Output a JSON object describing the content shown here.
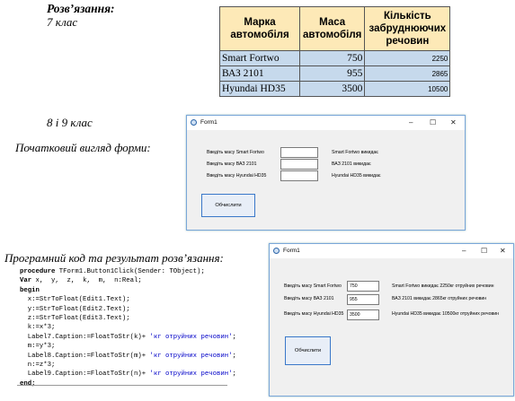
{
  "heading": "Розв’язання:",
  "grade7": "7 клас",
  "grade89": "8 і 9 клас",
  "initial_form_label": "Початковий вигляд форми:",
  "code_heading": "Програмний код та результат розв’язання:",
  "table": {
    "headers": [
      "Марка автомобіля",
      "Маса автомобіля",
      "Кількість забруднюючих речовин"
    ],
    "rows": [
      [
        "Smart Fortwo",
        "750",
        "2250"
      ],
      [
        "ВАЗ 2101",
        "955",
        "2865"
      ],
      [
        "Hyundai HD35",
        "3500",
        "10500"
      ]
    ]
  },
  "form1": {
    "title": "Form1",
    "controls": [
      "–",
      "☐",
      "✕"
    ],
    "labels": [
      "Введіть масу Smart Fortwo",
      "Введіть масу ВАЗ 2101",
      "Введіть масу Hyundai HD35"
    ],
    "inputs": [
      "",
      "",
      ""
    ],
    "results": [
      "Smart Fortwo викидає",
      "ВАЗ 2101 викидає",
      "Hyundai HD35 викидає"
    ],
    "button": "Обчислити"
  },
  "form2": {
    "title": "Form1",
    "controls": [
      "–",
      "☐",
      "✕"
    ],
    "labels": [
      "Введіть масу Smart Fortwo",
      "Введіть масу ВАЗ 2101",
      "Введіть масу Hyundai HD35"
    ],
    "inputs": [
      "750",
      "955",
      "3500"
    ],
    "results": [
      "Smart Fortwo викидає  2250кг отруйних речовин",
      "ВАЗ 2101  викидає   2865кг отруйних речовин",
      "Hyundai HD35  викидає  10500кг отруйних речовин"
    ],
    "button": "Обчислити"
  },
  "code": {
    "l1": [
      "procedure",
      " TForm1.Button1Click(Sender: TObject);"
    ],
    "l2": [
      "Var",
      " x,  y,  z,  k,  m,  n:Real;"
    ],
    "l3": [
      "begin"
    ],
    "l4": "  x:=StrToFloat(Edit1.Text);",
    "l5": "  y:=StrToFloat(Edit2.Text);",
    "l6": "  z:=StrToFloat(Edit3.Text);",
    "l7": "  k:=x*3;",
    "l8": [
      "  Label7.Caption:=FloatToStr(k)+ ",
      "'кг отруйних речовин'",
      ";"
    ],
    "l9": "  m:=y*3;",
    "l10": [
      "  Label8.Caption:=FloatToStr(m)+ ",
      "'кг отруйних речовин'",
      ";"
    ],
    "l11": "  n:=z*3;",
    "l12": [
      "  Label9.Caption:=FloatToStr(n)+ ",
      "'кг отруйних речовин'",
      ";"
    ],
    "l13": [
      "end;"
    ]
  }
}
